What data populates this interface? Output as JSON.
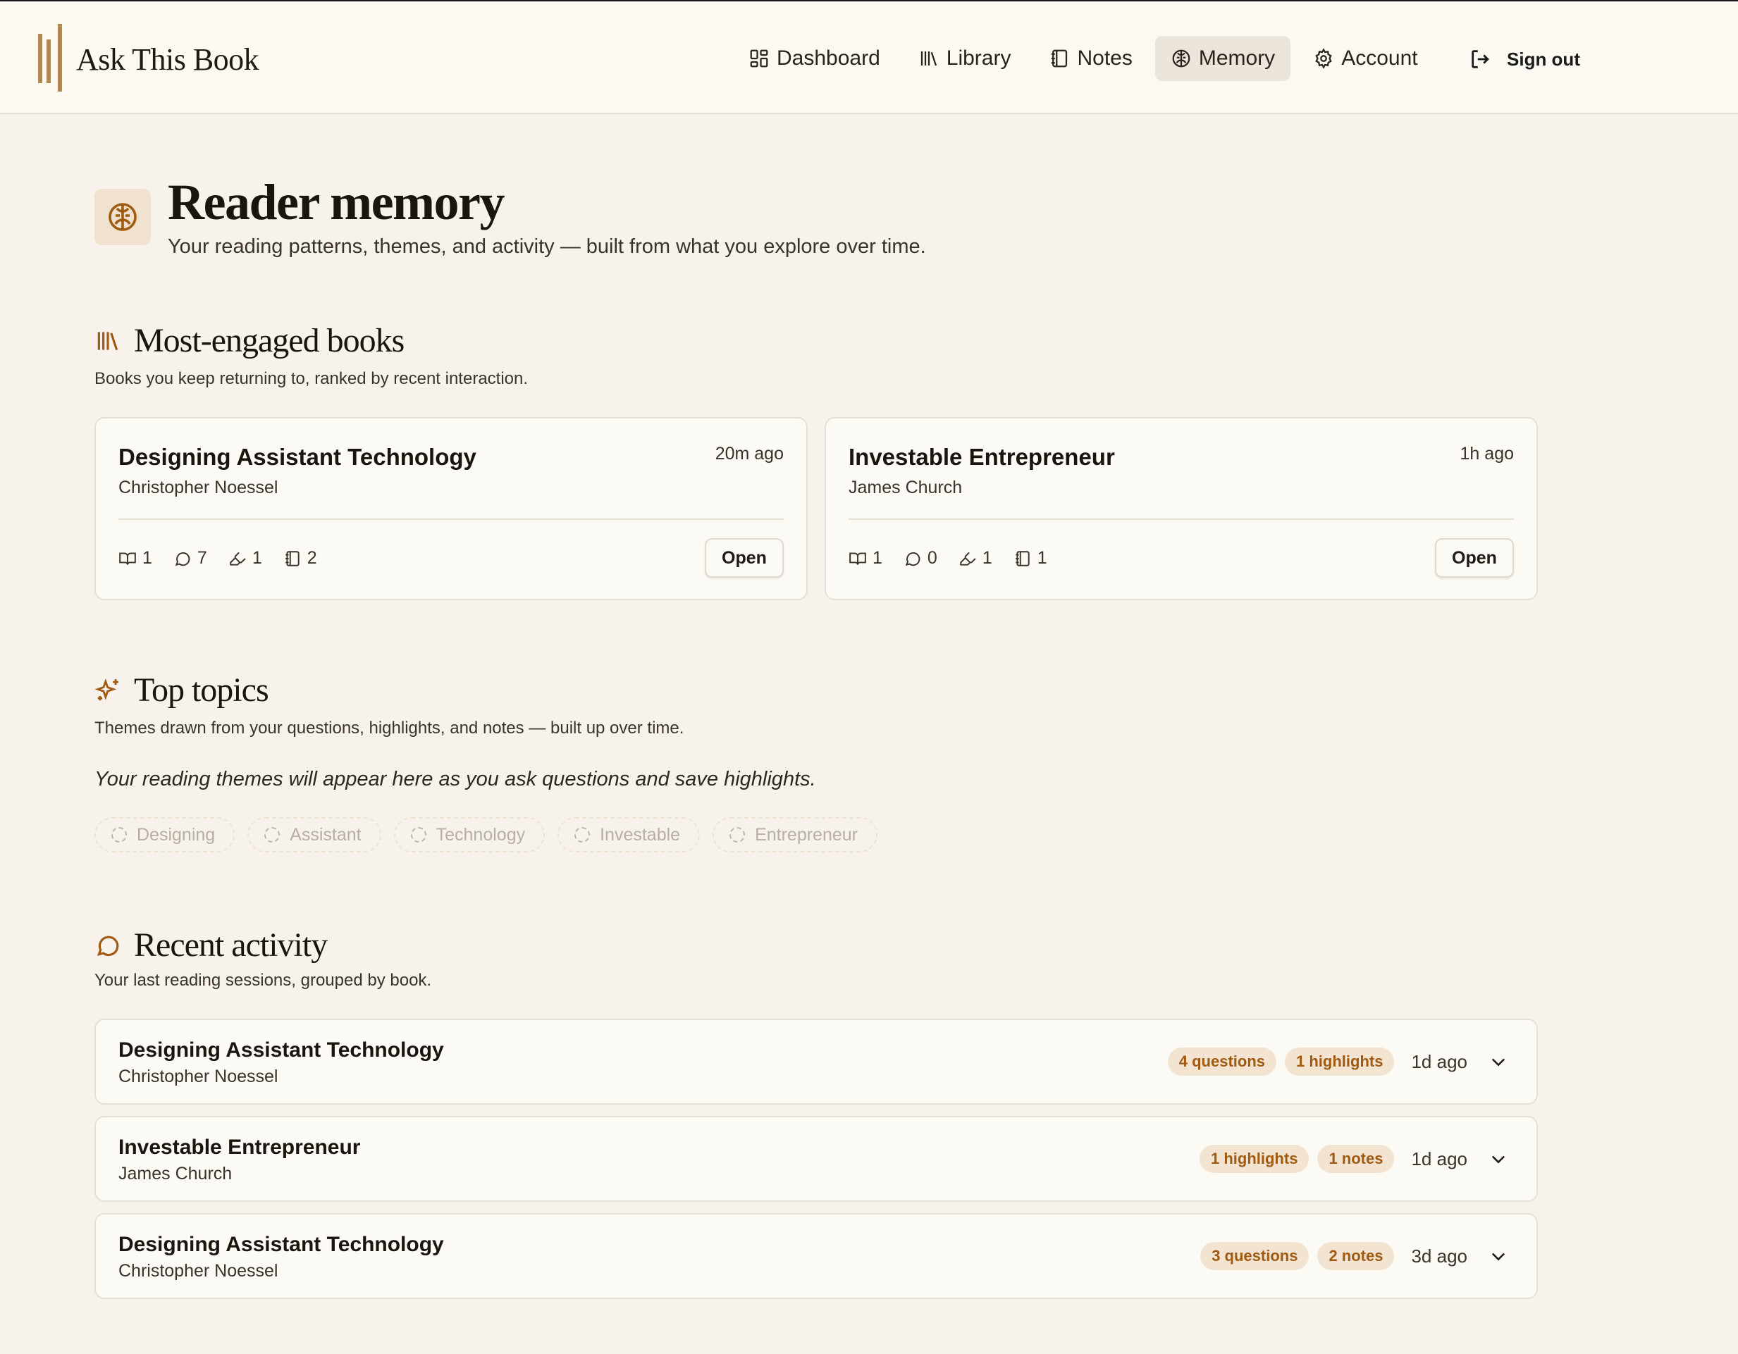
{
  "app": {
    "name": "Ask This Book"
  },
  "nav": {
    "items": [
      {
        "label": "Dashboard",
        "icon": "dashboard-icon"
      },
      {
        "label": "Library",
        "icon": "library-icon"
      },
      {
        "label": "Notes",
        "icon": "notebook-icon"
      },
      {
        "label": "Memory",
        "icon": "brain-icon",
        "active": true
      },
      {
        "label": "Account",
        "icon": "gear-icon"
      }
    ],
    "signout_label": "Sign out"
  },
  "page": {
    "title": "Reader memory",
    "subtitle": "Your reading patterns, themes, and activity — built from what you explore over time."
  },
  "engaged": {
    "title": "Most-engaged books",
    "subtitle": "Books you keep returning to, ranked by recent interaction.",
    "books": [
      {
        "title": "Designing Assistant Technology",
        "author": "Christopher Noessel",
        "time": "20m ago",
        "stats": {
          "reads": "1",
          "questions": "7",
          "highlights": "1",
          "notes": "2"
        },
        "open_label": "Open"
      },
      {
        "title": "Investable Entrepreneur",
        "author": "James Church",
        "time": "1h ago",
        "stats": {
          "reads": "1",
          "questions": "0",
          "highlights": "1",
          "notes": "1"
        },
        "open_label": "Open"
      }
    ]
  },
  "topics": {
    "title": "Top topics",
    "subtitle": "Themes drawn from your questions, highlights, and notes — built up over time.",
    "empty_message": "Your reading themes will appear here as you ask questions and save highlights.",
    "chips": [
      "Designing",
      "Assistant",
      "Technology",
      "Investable",
      "Entrepreneur"
    ]
  },
  "activity": {
    "title": "Recent activity",
    "subtitle": "Your last reading sessions, grouped by book.",
    "rows": [
      {
        "title": "Designing Assistant Technology",
        "author": "Christopher Noessel",
        "badges": [
          "4 questions",
          "1 highlights"
        ],
        "time": "1d ago"
      },
      {
        "title": "Investable Entrepreneur",
        "author": "James Church",
        "badges": [
          "1 highlights",
          "1 notes"
        ],
        "time": "1d ago"
      },
      {
        "title": "Designing Assistant Technology",
        "author": "Christopher Noessel",
        "badges": [
          "3 questions",
          "2 notes"
        ],
        "time": "3d ago"
      }
    ]
  },
  "colors": {
    "accent": "#a05a12",
    "logo": "#b08a52",
    "background": "#f7f3ec",
    "card": "#fcfaf5",
    "badge_bg": "#f2e4d0"
  }
}
